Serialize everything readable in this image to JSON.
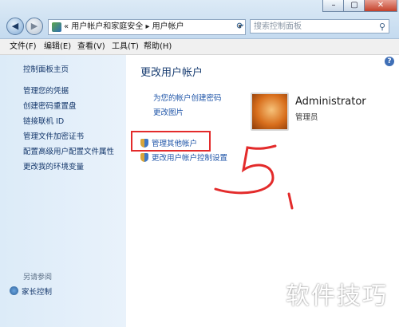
{
  "window": {
    "close_glyph": "✕"
  },
  "address_bar": {
    "breadcrumb": "«  用户帐户和家庭安全  ▸ 用户帐户",
    "search_placeholder": "搜索控制面板"
  },
  "menu": [
    "文件(F)",
    "编辑(E)",
    "查看(V)",
    "工具(T)",
    "帮助(H)"
  ],
  "sidebar": {
    "items": [
      "控制面板主页",
      "管理您的凭据",
      "创建密码重置盘",
      "链接联机 ID",
      "管理文件加密证书",
      "配置高级用户配置文件属性",
      "更改我的环境变量"
    ],
    "see_also": "另请参阅",
    "family_safety": "家长控制"
  },
  "main": {
    "heading": "更改用户帐户",
    "links": [
      "为您的帐户创建密码",
      "更改图片"
    ],
    "admin_links": [
      "管理其他帐户",
      "更改用户帐户控制设置"
    ]
  },
  "user": {
    "name": "Administrator",
    "role": "管理员"
  },
  "annotation": {
    "text": "5."
  },
  "watermark": "软件技巧"
}
